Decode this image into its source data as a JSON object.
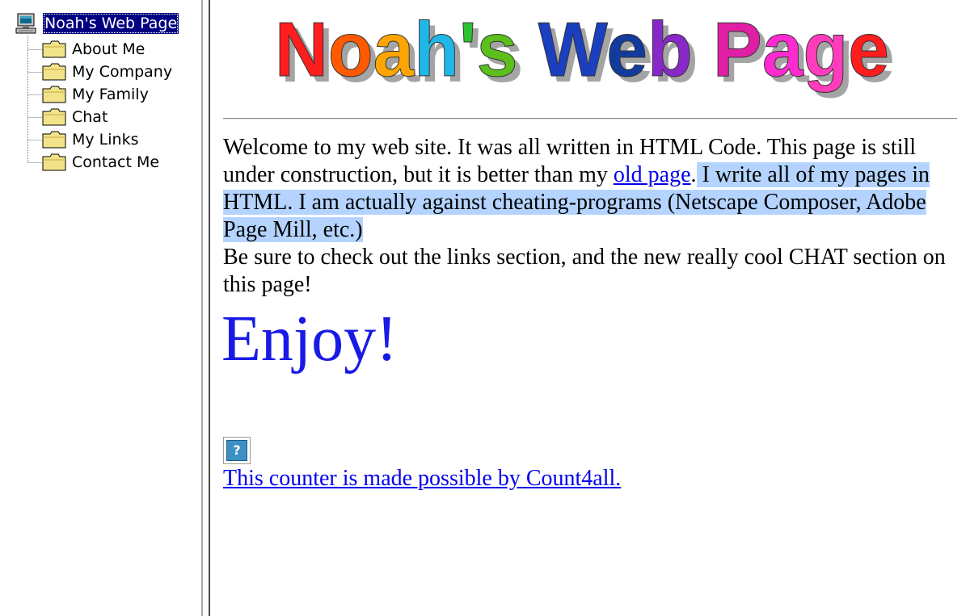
{
  "tree": {
    "root_label": "Noah's Web Page",
    "items": [
      {
        "label": "About Me"
      },
      {
        "label": "My Company"
      },
      {
        "label": "My Family"
      },
      {
        "label": "Chat"
      },
      {
        "label": "My Links"
      },
      {
        "label": "Contact Me"
      }
    ]
  },
  "main": {
    "banner_title": "Noah's Web Page",
    "banner_colors": [
      "#ff1d1d",
      "#ff5a00",
      "#ffa400",
      "#1fb7e8",
      "#2cc230",
      "#5bbf1c",
      "#1a3fbf",
      "#123c9c",
      "#8828c8",
      "#e01fa5",
      "#ff2ad0",
      "#ff3cbb"
    ],
    "welcome": {
      "part1": "Welcome to my web site. It was all written in HTML Code. This page is still under construction, but it is better than my ",
      "link_text": "old page",
      "part2": ".",
      "selected_text": " I write all of my pages in HTML. I am actually against cheating-programs (Netscape Composer, Adobe Page Mill, etc.)",
      "part3": "Be sure to check out the links section, and the new really cool CHAT section on this page!"
    },
    "enjoy": "Enjoy!",
    "counter_icon_text": "?",
    "counter_link": "This counter is made possible by Count4all."
  },
  "colors": {
    "tree_selection": "#000080",
    "text_selection": "#b4d4ff",
    "link": "#0000ee",
    "enjoy": "#1a1ae6"
  },
  "icons": {
    "root": "computer-icon",
    "item": "folder-icon"
  }
}
